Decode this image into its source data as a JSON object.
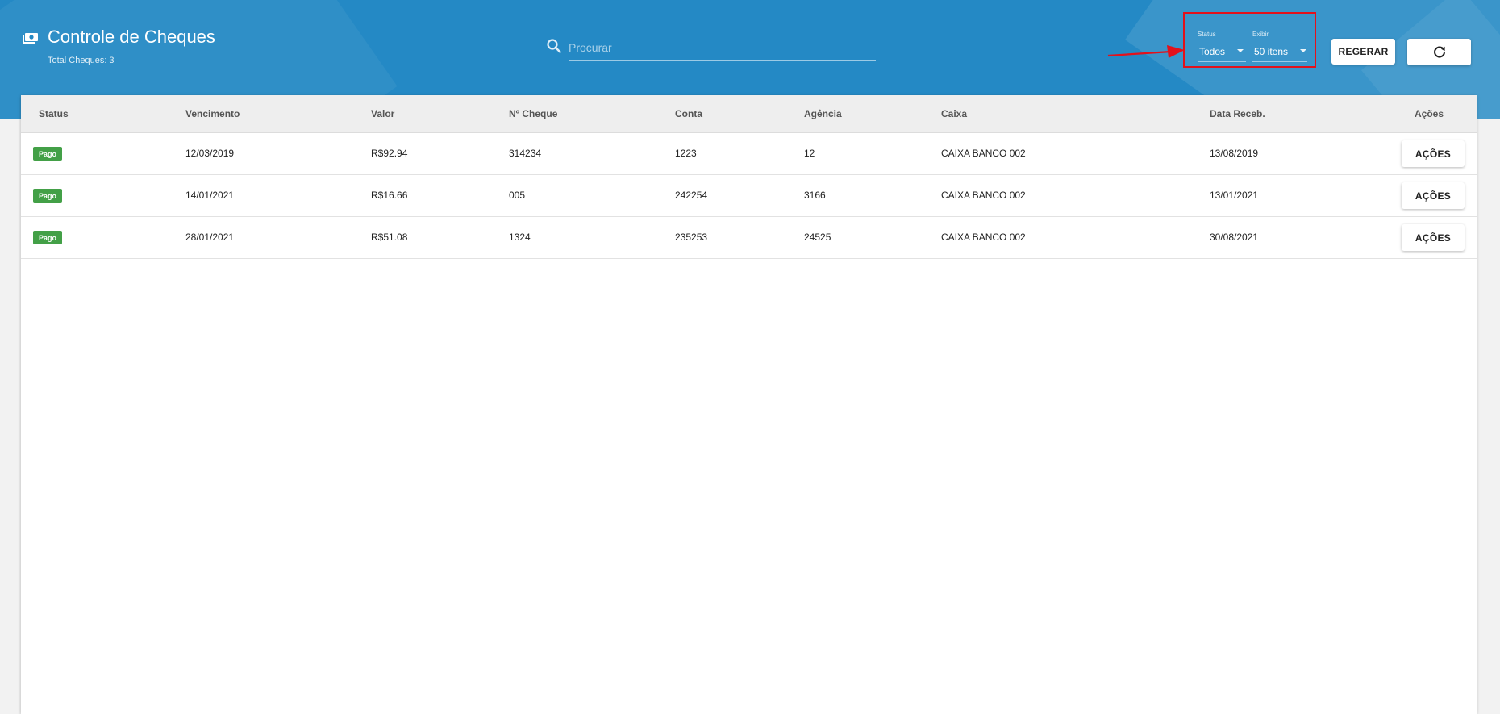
{
  "header": {
    "icon": "money-icon",
    "title": "Controle de Cheques",
    "subtitle": "Total Cheques: 3",
    "search_placeholder": "Procurar",
    "filters": {
      "status_label": "Status",
      "status_value": "Todos",
      "display_label": "Exibir",
      "display_value": "50 itens"
    },
    "regerar_label": "REGERAR",
    "refresh_icon": "refresh-icon"
  },
  "table": {
    "columns": [
      "Status",
      "Vencimento",
      "Valor",
      "Nº Cheque",
      "Conta",
      "Agência",
      "Caixa",
      "Data Receb.",
      "Ações"
    ],
    "rows": [
      {
        "status": "Pago",
        "vencimento": "12/03/2019",
        "valor": "R$92.94",
        "cheque": "314234",
        "conta": "1223",
        "agencia": "12",
        "caixa": "CAIXA BANCO 002",
        "data_receb": "13/08/2019",
        "acoes": "AÇÕES"
      },
      {
        "status": "Pago",
        "vencimento": "14/01/2021",
        "valor": "R$16.66",
        "cheque": "005",
        "conta": "242254",
        "agencia": "3166",
        "caixa": "CAIXA BANCO 002",
        "data_receb": "13/01/2021",
        "acoes": "AÇÕES"
      },
      {
        "status": "Pago",
        "vencimento": "28/01/2021",
        "valor": "R$51.08",
        "cheque": "1324",
        "conta": "235253",
        "agencia": "24525",
        "caixa": "CAIXA BANCO 002",
        "data_receb": "30/08/2021",
        "acoes": "AÇÕES"
      }
    ]
  },
  "colors": {
    "header_bg": "#2489c5",
    "status_paid": "#43a047",
    "annotation_red": "#e3111b"
  }
}
